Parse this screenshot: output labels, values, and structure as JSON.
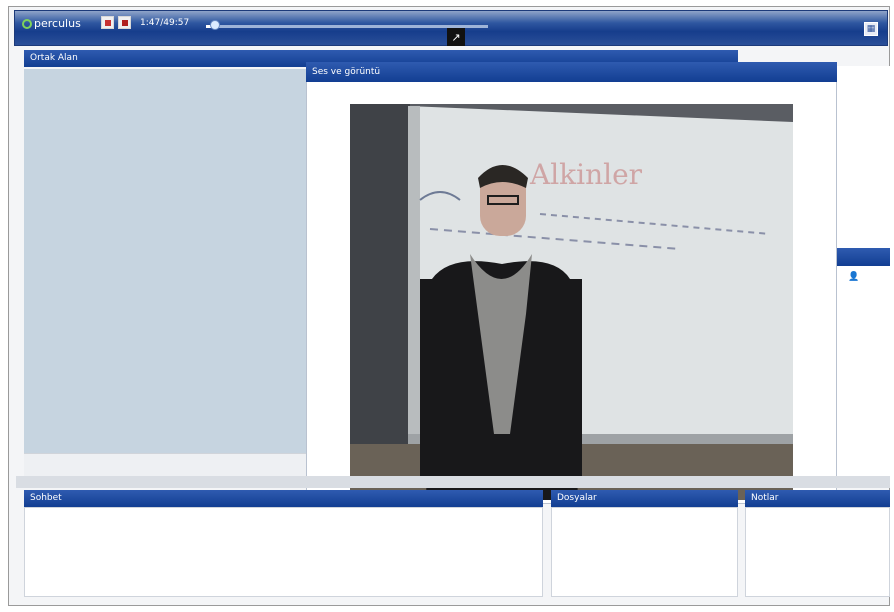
{
  "toolbar": {
    "app_name": "perculus",
    "time": "1:47/49:57",
    "progress": 0.02,
    "popout_icon": "popout-icon",
    "right_icon": "layout-icon"
  },
  "panels": {
    "shared_area": {
      "title": "Ortak Alan"
    },
    "audio_video": {
      "title": "Ses ve görüntü"
    },
    "chat": {
      "title": "Sohbet"
    },
    "files": {
      "title": "Dosyalar"
    },
    "notes": {
      "title": "Notlar"
    }
  },
  "video": {
    "whiteboard_text": "Alkinler"
  },
  "colors": {
    "header_blue": "#123e92",
    "accent": "#2f5bb0",
    "stop_red": "#c83232"
  }
}
